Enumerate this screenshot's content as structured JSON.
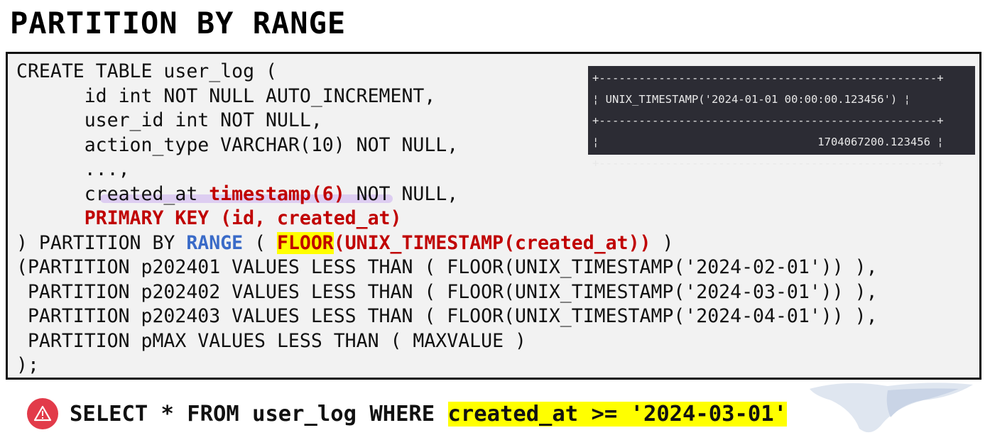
{
  "title": "PARTITION BY RANGE",
  "code": {
    "l1": "CREATE TABLE user_log (",
    "l2": "      id int NOT NULL AUTO_INCREMENT,",
    "l3": "      user_id int NOT NULL,",
    "l4": "      action_type VARCHAR(10) NOT NULL,",
    "l5": "      ...,",
    "l6_a": "      created_at ",
    "l6_b": "timestamp(6)",
    "l6_c": " NOT NULL,",
    "l7_indent": "      ",
    "l7_b": "PRIMARY KEY (id, created_at)",
    "l8_a": ") PARTITION BY ",
    "l8_b": "RANGE",
    "l8_c": " ( ",
    "l8_d": "FLOOR",
    "l8_e": "(UNIX_TIMESTAMP(created_at))",
    "l8_f": " )",
    "l9": "(PARTITION p202401 VALUES LESS THAN ( FLOOR(UNIX_TIMESTAMP('2024-02-01')) ),",
    "l10": " PARTITION p202402 VALUES LESS THAN ( FLOOR(UNIX_TIMESTAMP('2024-03-01')) ),",
    "l11": " PARTITION p202403 VALUES LESS THAN ( FLOOR(UNIX_TIMESTAMP('2024-04-01')) ),",
    "l12": " PARTITION pMAX VALUES LESS THAN ( MAXVALUE )",
    "l13": ");"
  },
  "result": {
    "border": "+---------------------------------------------------+",
    "header": "¦ UNIX_TIMESTAMP('2024-01-01 00:00:00.123456') ¦",
    "value": "¦                                 1704067200.123456 ¦"
  },
  "query": {
    "prefix": "SELECT * FROM user_log WHERE ",
    "highlight": "created_at >= '2024-03-01'"
  },
  "icons": {
    "warning": "warning-triangle-icon"
  },
  "colors": {
    "keyword_red": "#c00000",
    "keyword_blue": "#3a6bc8",
    "highlight": "#ffff00",
    "warning": "#e23b4a",
    "result_bg": "#2c2c34"
  }
}
